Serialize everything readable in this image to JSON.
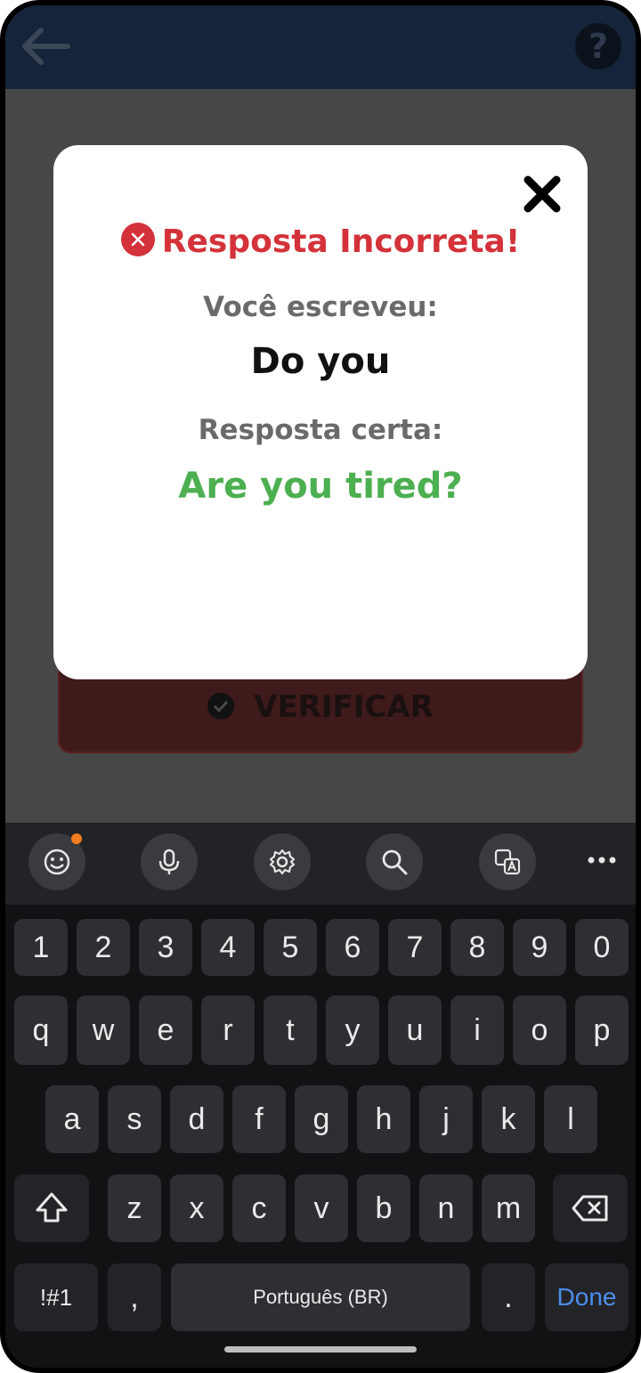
{
  "modal": {
    "title": "Resposta Incorreta!",
    "you_wrote_label": "Você escreveu:",
    "you_wrote_value": "Do you",
    "correct_label": "Resposta certa:",
    "correct_value": "Are you tired?"
  },
  "verify_button": {
    "label": "VERIFICAR"
  },
  "keyboard": {
    "number_row": [
      "1",
      "2",
      "3",
      "4",
      "5",
      "6",
      "7",
      "8",
      "9",
      "0"
    ],
    "row1": [
      "q",
      "w",
      "e",
      "r",
      "t",
      "y",
      "u",
      "i",
      "o",
      "p"
    ],
    "row2": [
      "a",
      "s",
      "d",
      "f",
      "g",
      "h",
      "j",
      "k",
      "l"
    ],
    "row3": [
      "z",
      "x",
      "c",
      "v",
      "b",
      "n",
      "m"
    ],
    "symbols_key": "!#1",
    "comma_key": ",",
    "space_label": "Português (BR)",
    "period_key": ".",
    "done_label": "Done"
  },
  "toolbar": {
    "icons": [
      "emoji-icon",
      "microphone-icon",
      "settings-icon",
      "search-icon",
      "translate-icon",
      "more-icon"
    ]
  },
  "colors": {
    "error": "#d4323a",
    "correct": "#4caf50",
    "app_bar": "#15243a",
    "done": "#4a8ef0"
  }
}
